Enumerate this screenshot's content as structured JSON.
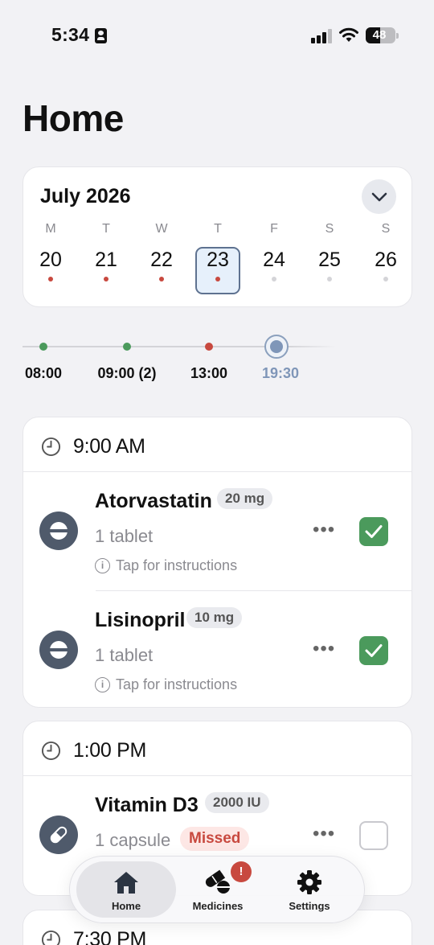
{
  "status_bar": {
    "time": "5:34",
    "battery": "48"
  },
  "page": {
    "title": "Home"
  },
  "calendar": {
    "month": "July 2026",
    "days": [
      {
        "weekday": "M",
        "date": "20",
        "dot": "#c8493f",
        "selected": false
      },
      {
        "weekday": "T",
        "date": "21",
        "dot": "#c8493f",
        "selected": false
      },
      {
        "weekday": "W",
        "date": "22",
        "dot": "#c8493f",
        "selected": false
      },
      {
        "weekday": "T",
        "date": "23",
        "dot": "#c8493f",
        "selected": true
      },
      {
        "weekday": "F",
        "date": "24",
        "dot": "#d4d4d8",
        "selected": false
      },
      {
        "weekday": "S",
        "date": "25",
        "dot": "#d4d4d8",
        "selected": false
      },
      {
        "weekday": "S",
        "date": "26",
        "dot": "#d4d4d8",
        "selected": false
      }
    ]
  },
  "timeline": [
    {
      "label": "08:00",
      "status": "taken",
      "color": "#4b9a5c"
    },
    {
      "label": "09:00 (2)",
      "status": "taken",
      "color": "#4b9a5c"
    },
    {
      "label": "13:00",
      "status": "missed",
      "color": "#c8493f"
    },
    {
      "label": "19:30",
      "status": "current",
      "color": "#7f96b8"
    }
  ],
  "dose_groups": [
    {
      "time": "9:00 AM",
      "meds": [
        {
          "name": "Atorvastatin",
          "dose": "20 mg",
          "qty": "1 tablet",
          "instructions": "Tap for instructions",
          "status": "taken",
          "icon": "tablet-icon"
        },
        {
          "name": "Lisinopril",
          "dose": "10 mg",
          "qty": "1 tablet",
          "instructions": "Tap for instructions",
          "status": "taken",
          "icon": "tablet-icon"
        }
      ]
    },
    {
      "time": "1:00 PM",
      "meds": [
        {
          "name": "Vitamin D3",
          "dose": "2000 IU",
          "qty": "1 capsule",
          "badge": "Missed",
          "status": "missed",
          "icon": "capsule-icon"
        }
      ]
    },
    {
      "time": "7:30 PM"
    }
  ],
  "tabs": [
    {
      "label": "Home",
      "icon": "house-icon",
      "active": true
    },
    {
      "label": "Medicines",
      "icon": "pills-icon",
      "active": false,
      "alert": "!"
    },
    {
      "label": "Settings",
      "icon": "gear-icon",
      "active": false
    }
  ],
  "colors": {
    "accent": "#5e7290",
    "taken": "#4b9a5c",
    "missed": "#c8493f"
  }
}
